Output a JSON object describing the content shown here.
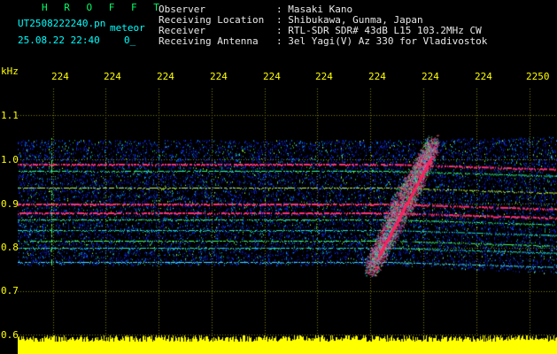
{
  "header": {
    "brand": "H R O F F T",
    "filename": "UT2508222240.pn",
    "meteor_label": "meteor",
    "datetime": "25.08.22 22:40",
    "extra": "0_",
    "rows": [
      {
        "label": "Observer",
        "value": ": Masaki Kano"
      },
      {
        "label": "Receiving Location",
        "value": ": Shibukawa, Gunma, Japan"
      },
      {
        "label": "Receiver",
        "value": ": RTL-SDR SDR# 43dB L15 103.2MHz CW"
      },
      {
        "label": "Receiving Antenna",
        "value": ": 3el Yagi(V) Az 330 for Vladivostok"
      }
    ]
  },
  "axis": {
    "unit": "kHz",
    "x_ticks": [
      "224",
      "224",
      "224",
      "224",
      "224",
      "224",
      "224",
      "224",
      "224",
      "2250"
    ],
    "y_ticks": [
      "1.1",
      "1.0",
      "0.9",
      "0.8",
      "0.7",
      "0.6"
    ]
  },
  "colors": {
    "background": "#000000",
    "text_header": "#00ffff",
    "text_label": "#e8e8e8",
    "axis_yellow": "#ffff00",
    "noise_blue": "#0a1aa0",
    "signal_red": "#ff2060"
  }
}
